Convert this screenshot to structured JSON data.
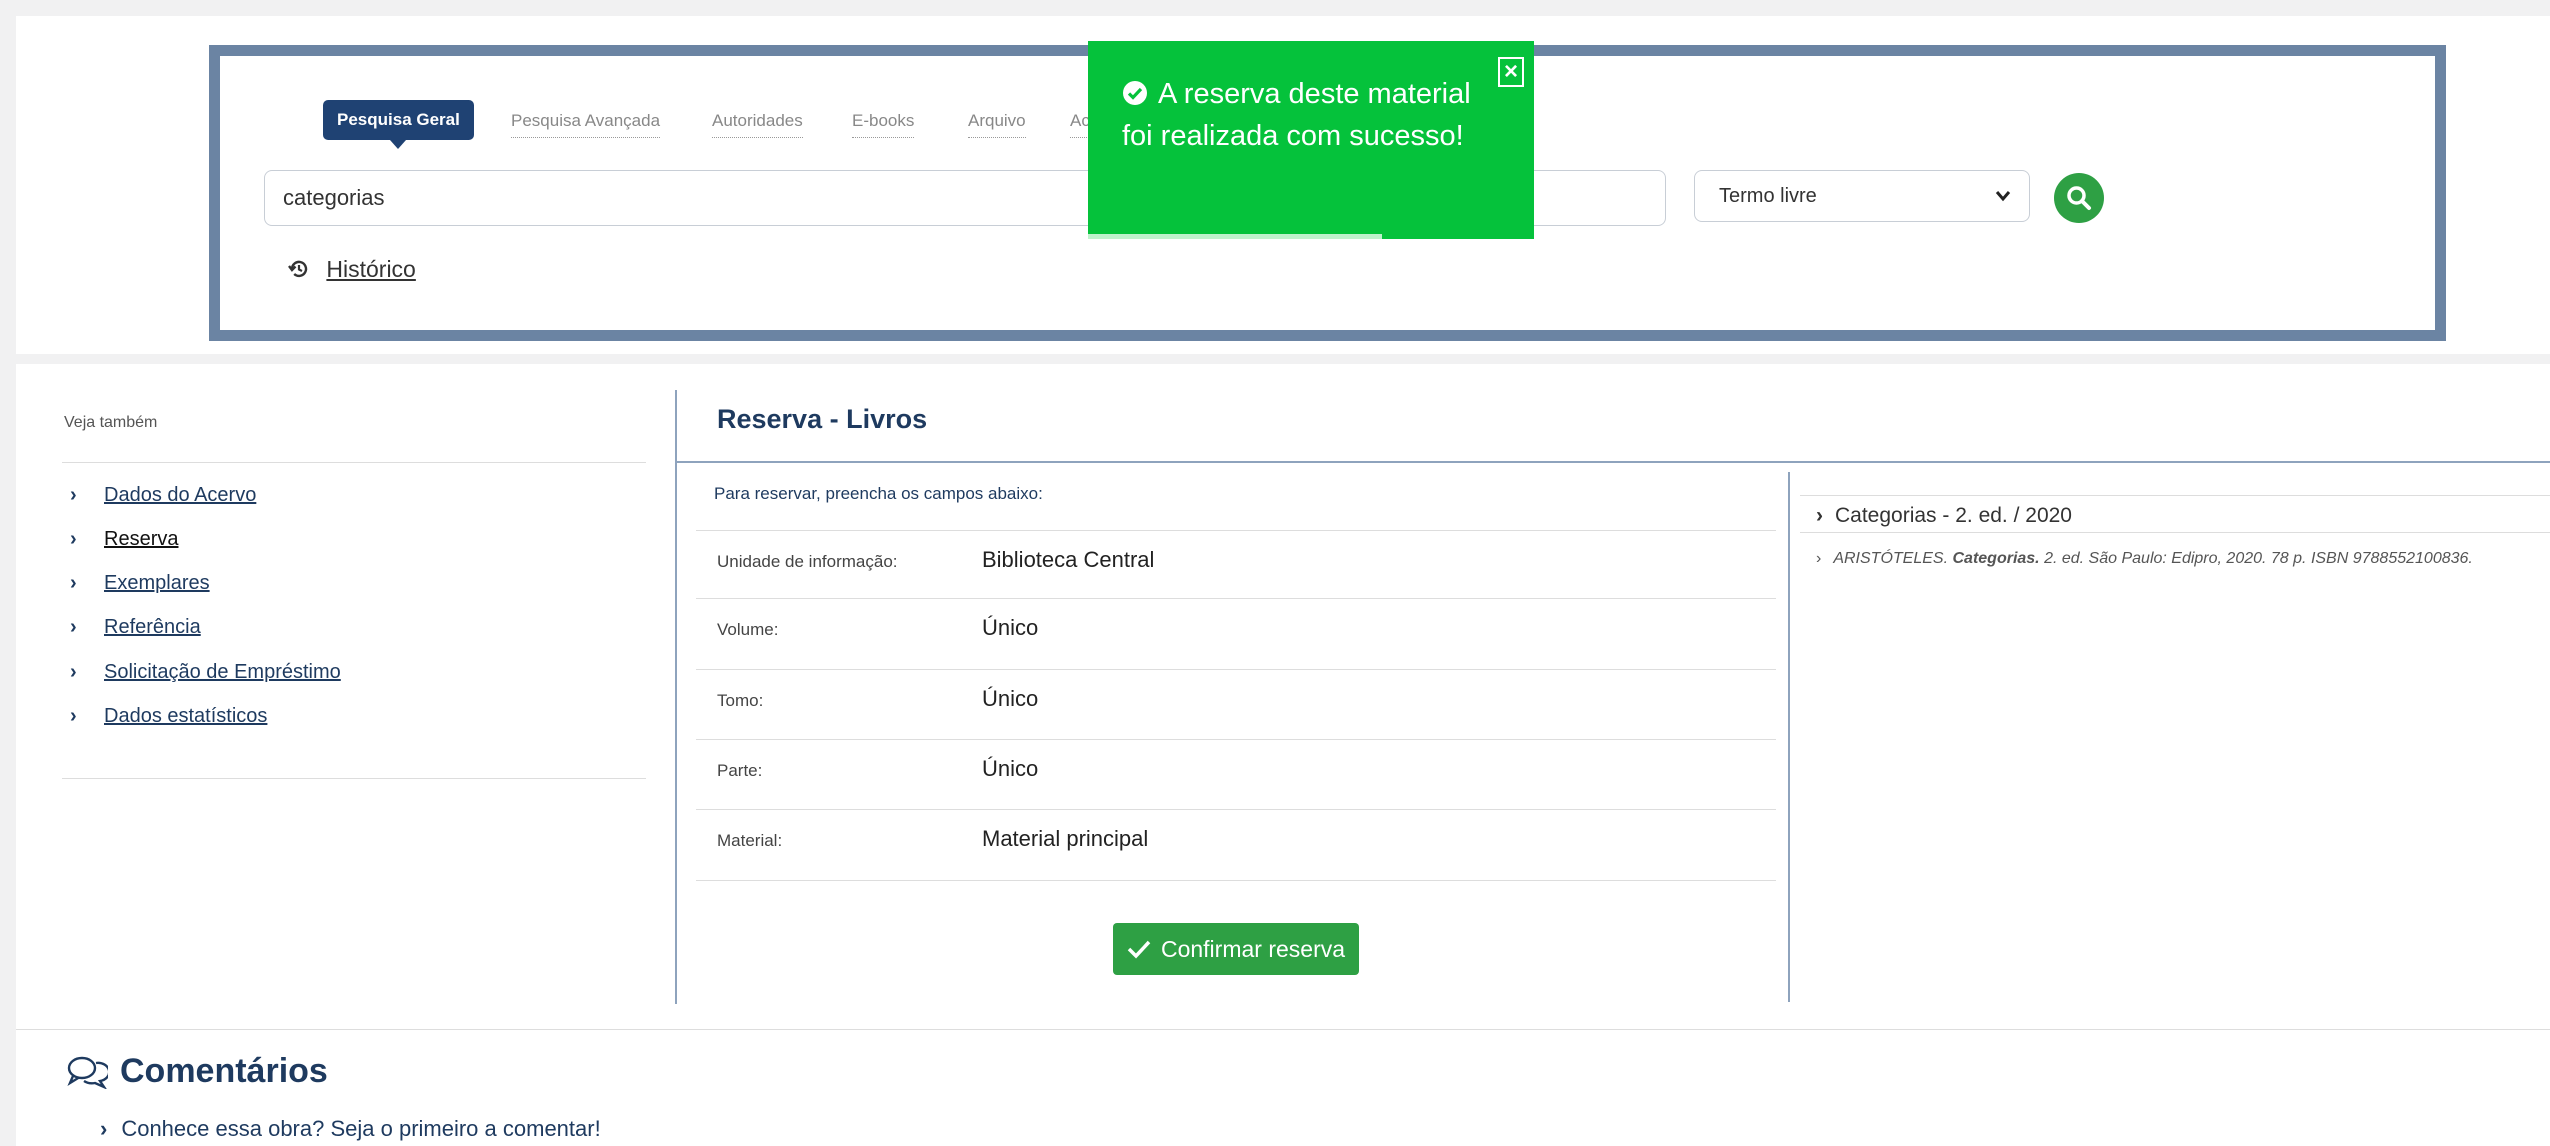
{
  "search": {
    "tabs": [
      "Pesquisa Geral",
      "Pesquisa Avançada",
      "Autoridades",
      "E-books",
      "Arquivo",
      "Ace"
    ],
    "query": "categorias",
    "select_value": "Termo livre",
    "history_label": "Histórico"
  },
  "toast": {
    "message": "A reserva deste material foi realizada com sucesso!",
    "close_label": "×",
    "progress": 0.66
  },
  "sidebar": {
    "heading": "Veja também",
    "items": [
      "Dados do Acervo",
      "Reserva",
      "Exemplares",
      "Referência",
      "Solicitação de Empréstimo",
      "Dados estatísticos"
    ],
    "current_index": 1
  },
  "reservation": {
    "title": "Reserva - Livros",
    "hint": "Para reservar, preencha os campos abaixo:",
    "fields": [
      {
        "label": "Unidade de informação:",
        "value": "Biblioteca Central"
      },
      {
        "label": "Volume:",
        "value": "Único"
      },
      {
        "label": "Tomo:",
        "value": "Único"
      },
      {
        "label": "Parte:",
        "value": "Único"
      },
      {
        "label": "Material:",
        "value": "Material principal"
      }
    ],
    "confirm_label": "Confirmar reserva"
  },
  "record": {
    "title": "Categorias - 2. ed. / 2020",
    "author": "ARISTÓTELES.",
    "work": "Categorias.",
    "details": "2. ed. São Paulo: Edipro, 2020. 78 p. ISBN 9788552100836."
  },
  "comments": {
    "title": "Comentários",
    "prompt": "Conhece essa obra? Seja o primeiro a comentar!"
  },
  "colors": {
    "primary": "#1f4273",
    "frame": "#6b84a3",
    "success": "#05c23b",
    "button": "#2ea044"
  }
}
